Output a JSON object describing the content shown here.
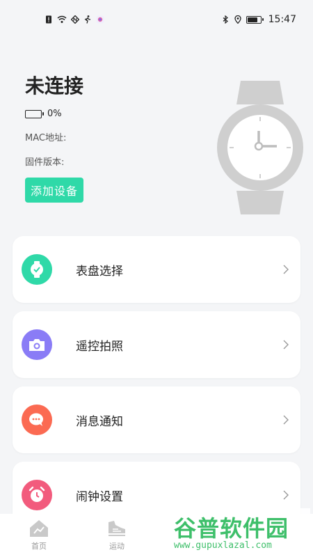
{
  "status_bar": {
    "time": "15:47",
    "icons": [
      "sim-alert-icon",
      "wifi-icon",
      "nfc-icon",
      "walk-icon",
      "app-icon"
    ],
    "right_icons": [
      "bluetooth-icon",
      "location-icon",
      "battery-icon"
    ]
  },
  "device": {
    "status": "未连接",
    "battery": "0%",
    "mac_label": "MAC地址:",
    "firmware_label": "固件版本:",
    "add_button": "添加设备"
  },
  "menu": [
    {
      "label": "表盘选择",
      "icon": "watch-face-icon",
      "color": "#2fd9a8"
    },
    {
      "label": "遥控拍照",
      "icon": "camera-icon",
      "color": "#8a7cf6"
    },
    {
      "label": "消息通知",
      "icon": "message-icon",
      "color": "#fb6a52"
    },
    {
      "label": "闹钟设置",
      "icon": "alarm-clock-icon",
      "color": "#f25b7d"
    }
  ],
  "tabs": [
    {
      "label": "首页",
      "icon": "home-icon"
    },
    {
      "label": "运动",
      "icon": "shoe-icon"
    }
  ],
  "watermark": {
    "title": "谷普软件园",
    "url": "www.gupuxlazal.com"
  }
}
